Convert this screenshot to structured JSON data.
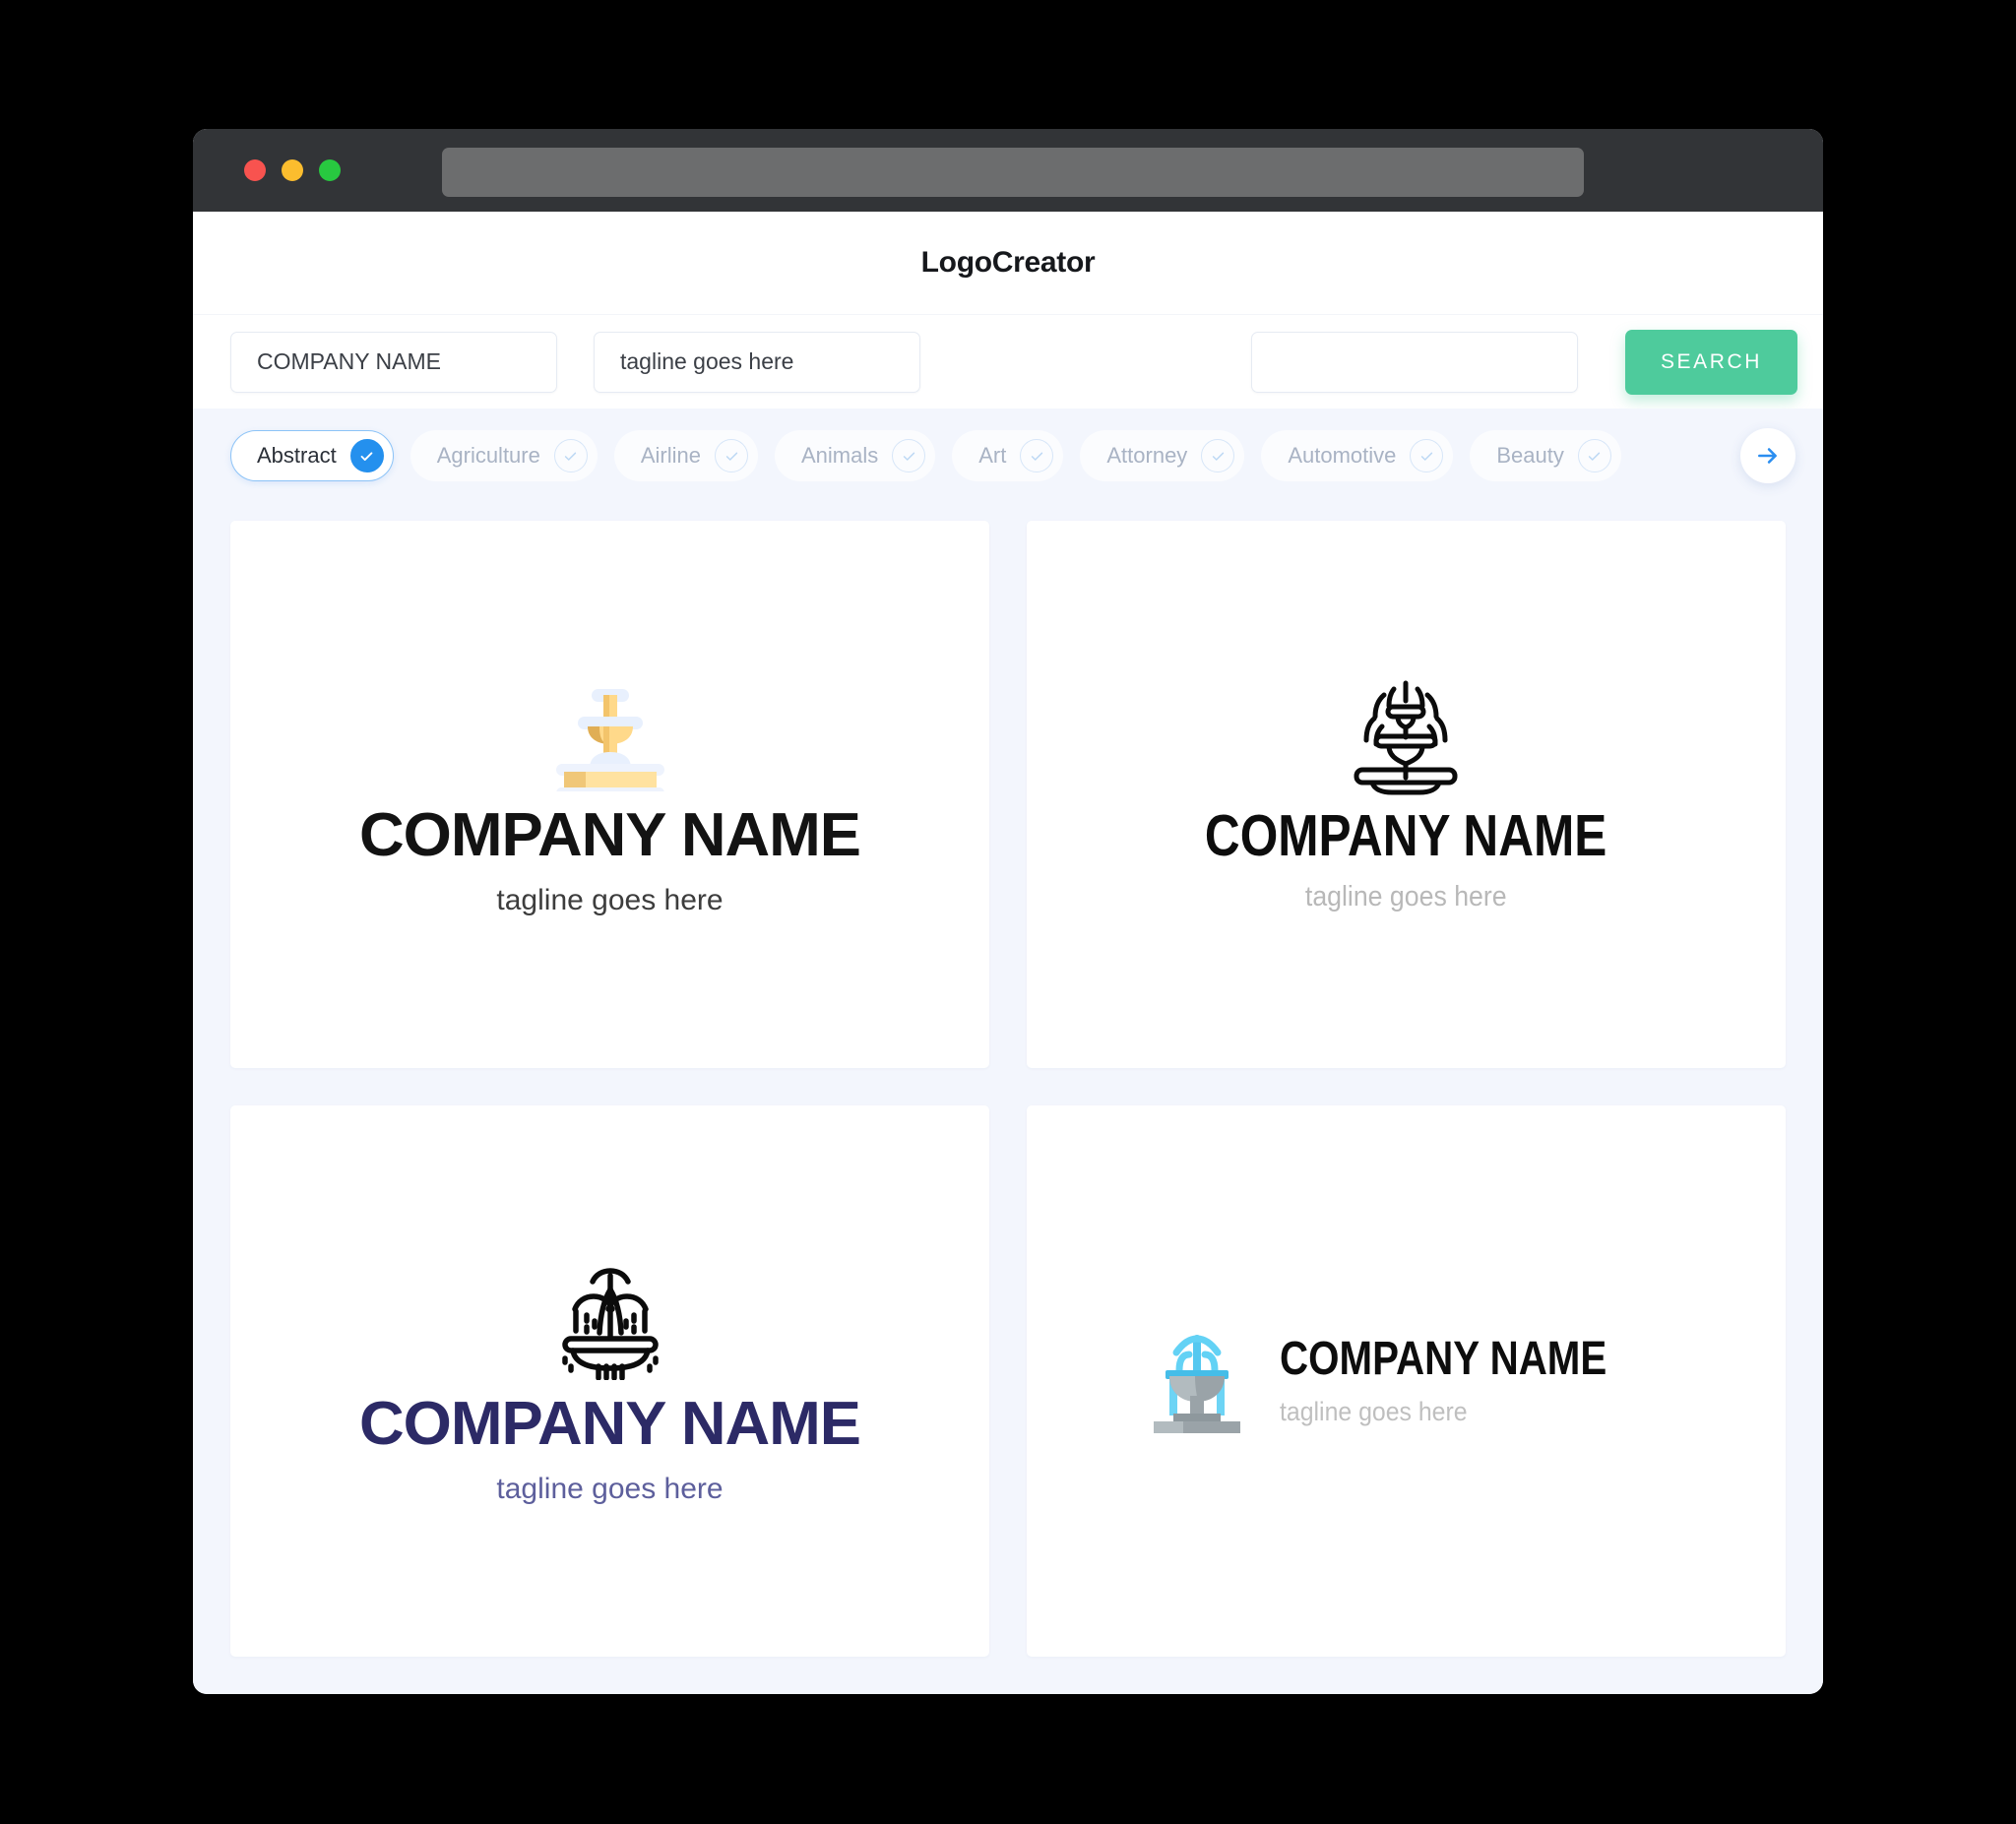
{
  "window": {
    "traffic_lights": [
      "close",
      "minimize",
      "maximize"
    ],
    "url_bar_value": ""
  },
  "header": {
    "app_title": "LogoCreator"
  },
  "search": {
    "company_name_value": "COMPANY NAME",
    "company_name_placeholder": "COMPANY NAME",
    "tagline_value": "tagline goes here",
    "tagline_placeholder": "tagline goes here",
    "keyword_value": "",
    "keyword_placeholder": "",
    "search_button_label": "SEARCH"
  },
  "categories": {
    "next_icon": "arrow-right-icon",
    "items": [
      {
        "label": "Abstract",
        "selected": true
      },
      {
        "label": "Agriculture",
        "selected": false
      },
      {
        "label": "Airline",
        "selected": false
      },
      {
        "label": "Animals",
        "selected": false
      },
      {
        "label": "Art",
        "selected": false
      },
      {
        "label": "Attorney",
        "selected": false
      },
      {
        "label": "Automotive",
        "selected": false
      },
      {
        "label": "Beauty",
        "selected": false
      }
    ]
  },
  "logos": [
    {
      "icon": "fountain-flat-cream-icon",
      "name": "COMPANY NAME",
      "tagline": "tagline goes here",
      "name_color": "#131313",
      "tagline_color": "#3d3d3d",
      "layout": "stacked"
    },
    {
      "icon": "fountain-lineart-tiered-icon",
      "name": "COMPANY NAME",
      "tagline": "tagline goes here",
      "name_color": "#0d0d0d",
      "tagline_color": "#b8b8b8",
      "layout": "stacked"
    },
    {
      "icon": "fountain-lineart-spray-icon",
      "name": "COMPANY NAME",
      "tagline": "tagline goes here",
      "name_color": "#2c2a66",
      "tagline_color": "#5d5f9c",
      "layout": "stacked"
    },
    {
      "icon": "fountain-flat-blue-gray-icon",
      "name": "COMPANY NAME",
      "tagline": "tagline goes here",
      "name_color": "#0d0d0d",
      "tagline_color": "#bfbfbf",
      "layout": "horizontal"
    }
  ],
  "colors": {
    "accent_green": "#4ecb9c",
    "accent_blue": "#2490ee",
    "page_background": "#f3f6fd",
    "titlebar": "#323437"
  }
}
